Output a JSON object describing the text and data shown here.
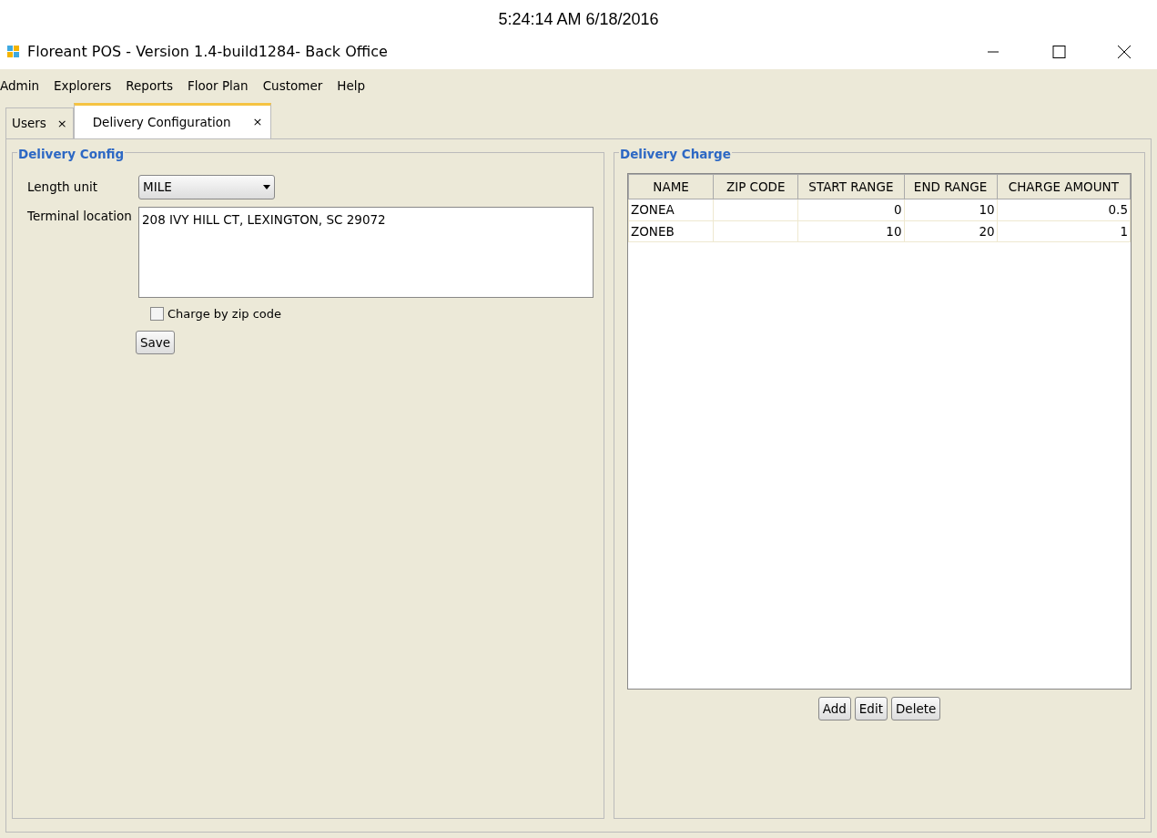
{
  "clock": "5:24:14 AM 6/18/2016",
  "window": {
    "title": "Floreant POS - Version 1.4-build1284- Back Office"
  },
  "menu": [
    "Admin",
    "Explorers",
    "Reports",
    "Floor Plan",
    "Customer",
    "Help"
  ],
  "tabs": [
    {
      "label": "Users",
      "close": "×",
      "selected": false
    },
    {
      "label": "Delivery Configuration",
      "close": "×",
      "selected": true
    }
  ],
  "delivery_config": {
    "title": "Delivery Config",
    "length_unit_label": "Length unit",
    "length_unit": "MILE",
    "terminal_location_label": "Terminal location",
    "terminal_location": "208 IVY HILL CT, LEXINGTON, SC 29072",
    "charge_by_zip": {
      "label": "Charge by zip code",
      "checked": false
    },
    "save": "Save"
  },
  "delivery_charge": {
    "title": "Delivery Charge",
    "table": {
      "columns": [
        "NAME",
        "ZIP CODE",
        "START RANGE",
        "END RANGE",
        "CHARGE AMOUNT"
      ],
      "rows": [
        [
          "ZONEA",
          "",
          "0",
          "10",
          "0.5"
        ],
        [
          "ZONEB",
          "",
          "10",
          "20",
          "1"
        ]
      ]
    },
    "buttons": [
      "Add",
      "Edit",
      "Delete"
    ]
  }
}
